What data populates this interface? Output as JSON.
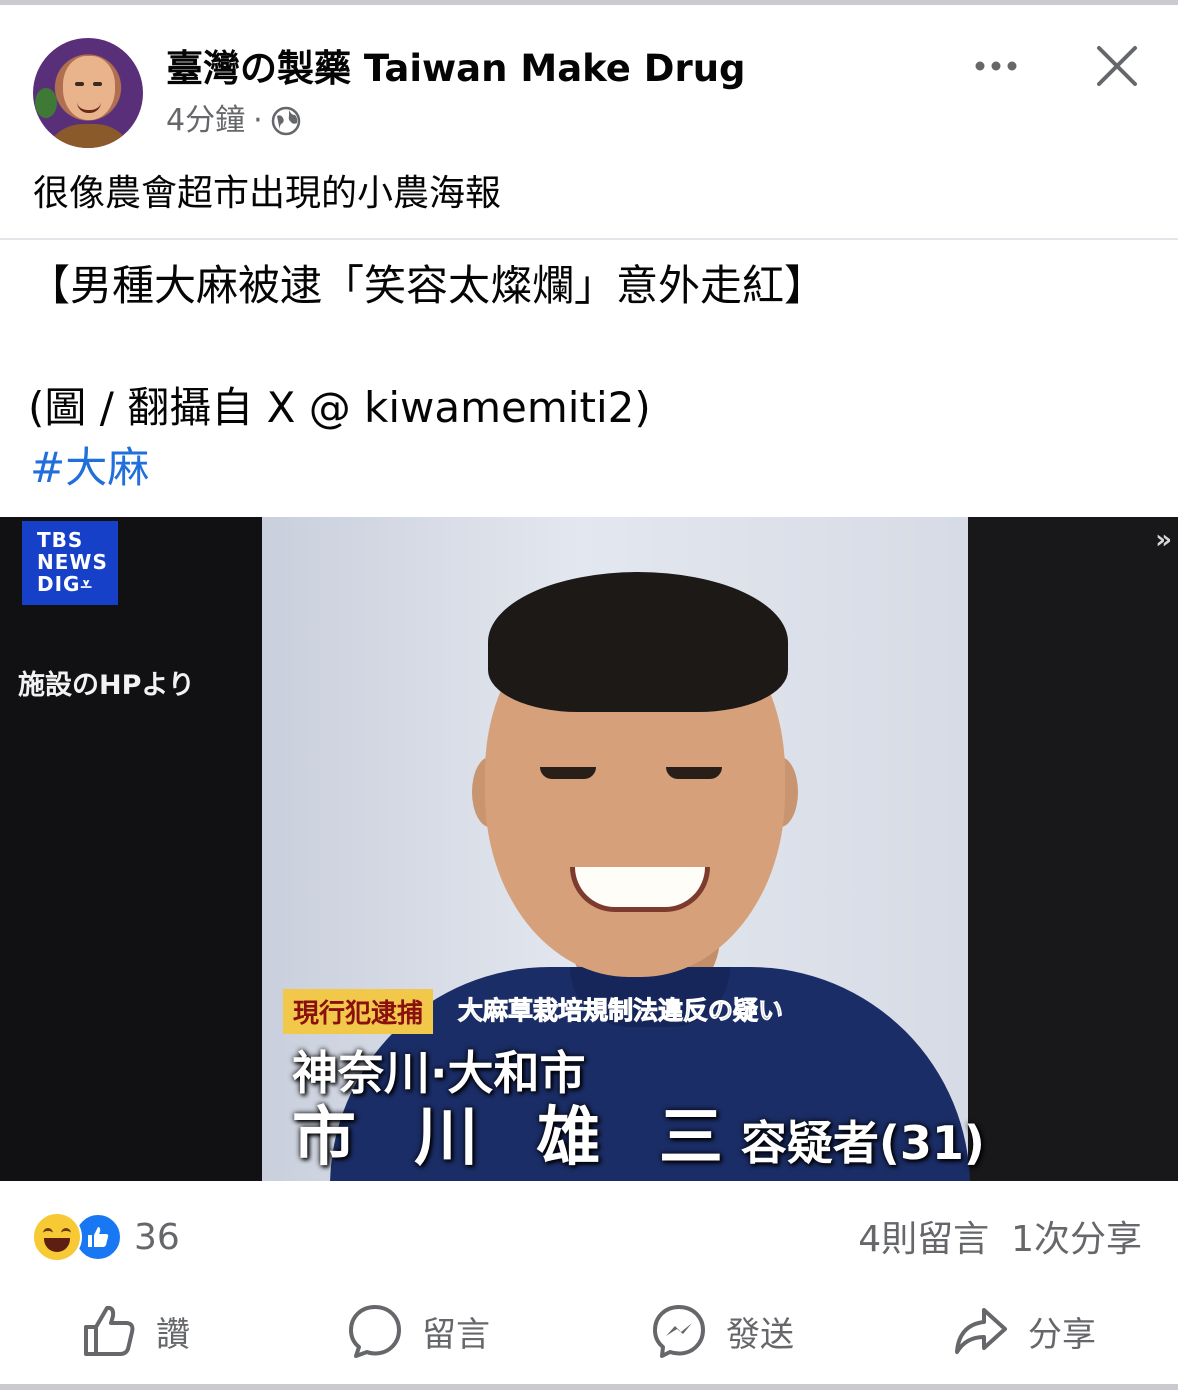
{
  "post": {
    "page_name": "臺灣の製藥 Taiwan Make Drug",
    "time": "4分鐘",
    "separator": "·",
    "caption": "很像農會超市出現的小農海報"
  },
  "shared": {
    "headline": "【男種大麻被逮「笑容太燦爛」意外走紅】",
    "credit": "(圖 / 翻攝自 X @ kiwamemiti2)",
    "hashtag": "#大麻"
  },
  "photo": {
    "logo_lines": [
      "TBS",
      "NEWS",
      "DIG"
    ],
    "source_note": "施設のHPより",
    "tag_arrest": "現行犯逮捕",
    "tag_charge": "大麻草栽培規制法違反の疑い",
    "location": "神奈川·大和市",
    "suspect_name": "市 川 雄 三",
    "suspect_title": "容疑者(31)"
  },
  "engagement": {
    "reaction_count": "36",
    "comments": "4則留言",
    "shares": "1次分享"
  },
  "actions": {
    "like": "讚",
    "comment": "留言",
    "send": "發送",
    "share": "分享"
  },
  "colors": {
    "hashtag": "#216fdb",
    "secondary_text": "#65676b",
    "like_blue": "#1877f2",
    "tbs_blue": "#1640c8"
  }
}
